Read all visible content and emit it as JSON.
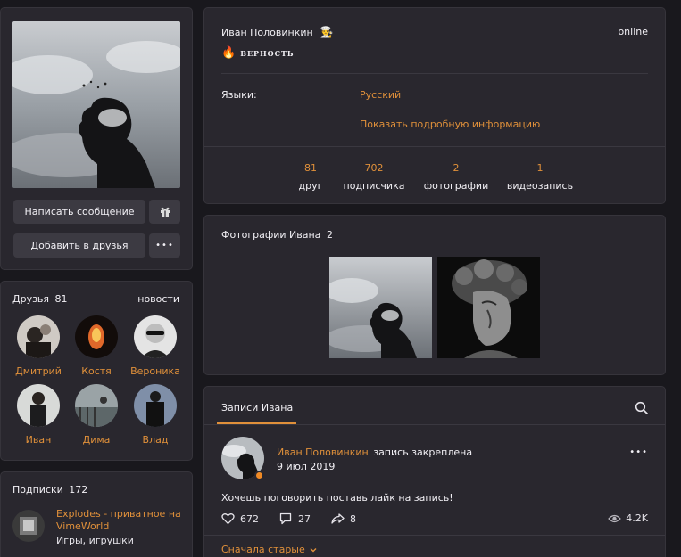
{
  "profile": {
    "write_message_label": "Написать сообщение",
    "add_friend_label": "Добавить в друзья",
    "more_label": "•••"
  },
  "friends": {
    "title": "Друзья",
    "count": "81",
    "news_link": "новости",
    "items": [
      {
        "name": "Дмитрий"
      },
      {
        "name": "Костя"
      },
      {
        "name": "Вероника"
      },
      {
        "name": "Иван"
      },
      {
        "name": "Дима"
      },
      {
        "name": "Влад"
      }
    ]
  },
  "subscriptions": {
    "title": "Подписки",
    "count": "172",
    "items": [
      {
        "name": "Explodes - приватное на VimeWorld",
        "category": "Игры, игрушки"
      }
    ]
  },
  "info": {
    "name": "Иван Половинкин",
    "status_text": "online",
    "slogan": "ВЕРНОСТЬ",
    "languages_label": "Языки:",
    "languages_value": "Русский",
    "more_info_link": "Показать подробную информацию",
    "stats": [
      {
        "num": "81",
        "label": "друг"
      },
      {
        "num": "702",
        "label": "подписчика"
      },
      {
        "num": "2",
        "label": "фотографии"
      },
      {
        "num": "1",
        "label": "видеозапись"
      }
    ]
  },
  "photos": {
    "title": "Фотографии Ивана",
    "count": "2"
  },
  "posts": {
    "tab_label": "Записи Ивана",
    "post": {
      "author": "Иван Половинкин",
      "pinned_text": "запись закреплена",
      "date": "9 июл 2019",
      "text": "Хочешь поговорить поставь лайк на запись!",
      "likes": "672",
      "comments": "27",
      "shares": "8",
      "views": "4.2K"
    },
    "sort_label": "Сначала старые"
  },
  "colors": {
    "accent": "#e0903a",
    "card_bg": "#29272e",
    "page_bg": "#19181d"
  }
}
